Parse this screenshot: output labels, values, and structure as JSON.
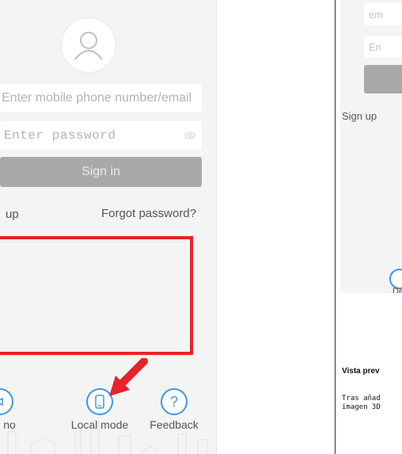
{
  "left": {
    "avatar_icon": "user-icon",
    "phone_placeholder": "Enter mobile phone number/email",
    "password_placeholder": "Enter password",
    "eye_icon": "eye-icon",
    "signin_label": "Sign in",
    "signup_label": "up",
    "forgot_label": "Forgot password?",
    "bottom": {
      "demo_label": "no",
      "local_label": "Local mode",
      "feedback_label": "Feedback",
      "feedback_glyph": "?"
    },
    "colors": {
      "accent": "#3d97e6",
      "highlight": "#e8232a",
      "button": "#a9a9a9"
    }
  },
  "right": {
    "email_placeholder": "em",
    "password_placeholder": "En",
    "signup_label": "Sign up",
    "bottom_label": "De"
  },
  "text": {
    "heading": "Vista prev",
    "line1": "Tras añad",
    "line2": "imagen 3D"
  }
}
